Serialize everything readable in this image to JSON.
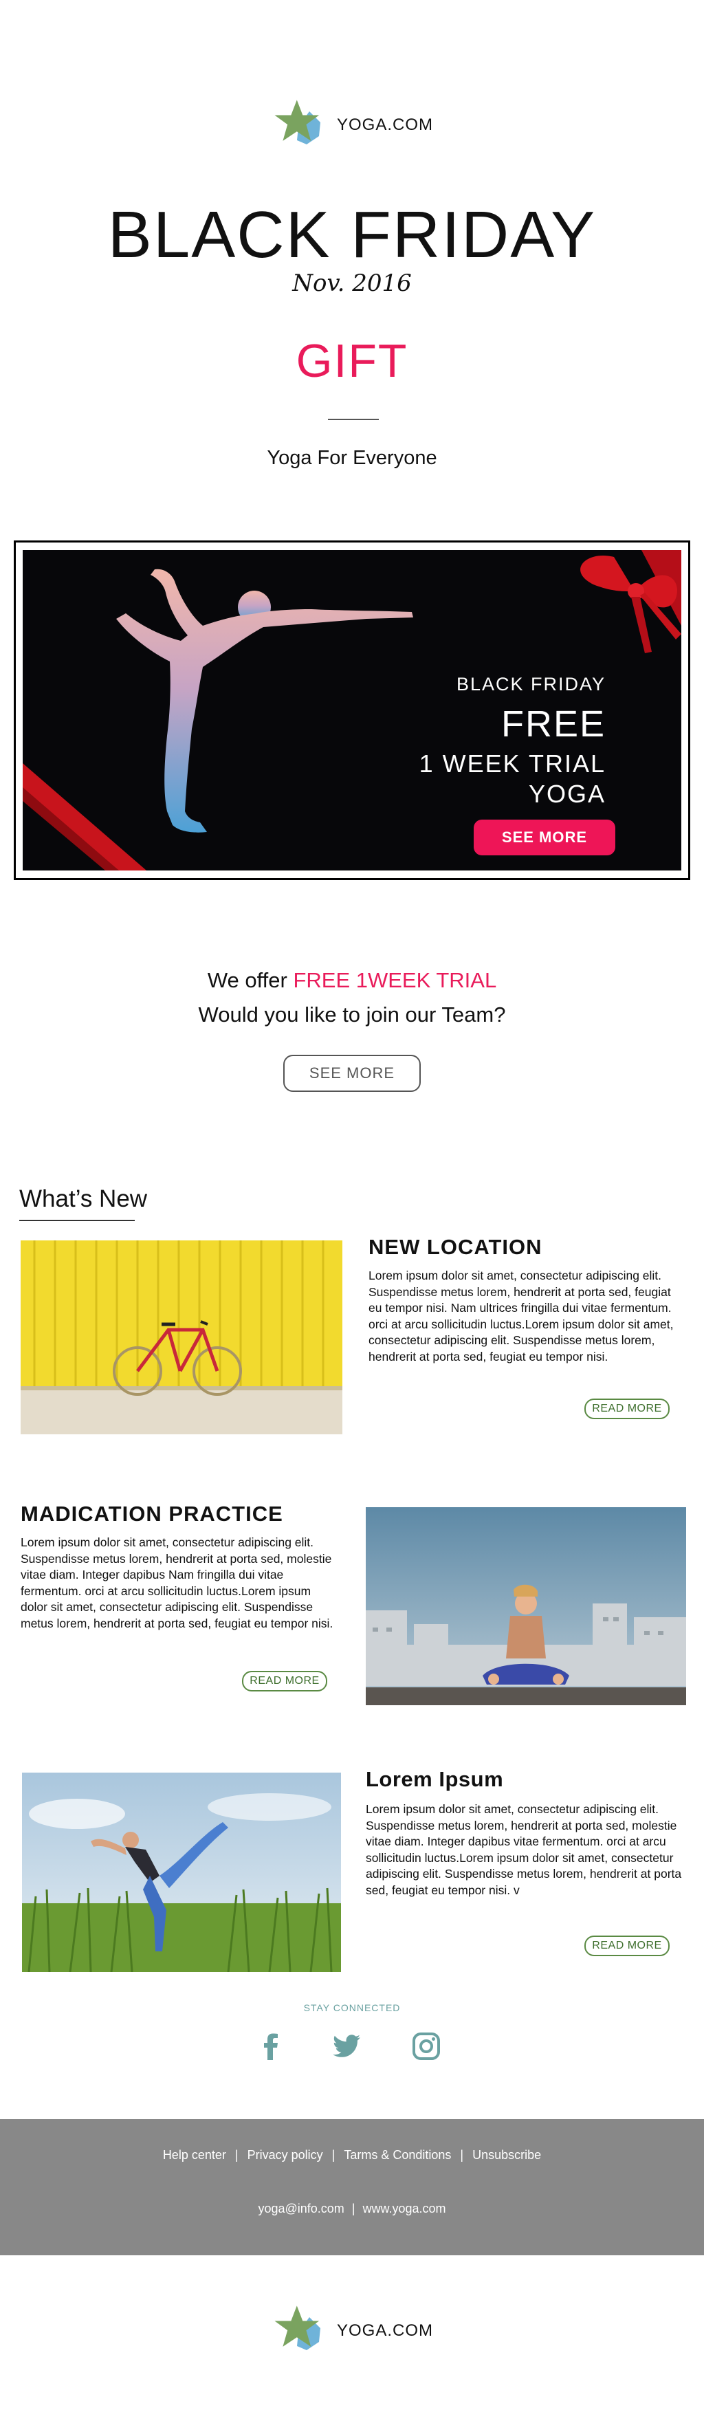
{
  "brand": {
    "name": "YOGA.COM"
  },
  "header": {
    "title": "BLACK FRIDAY",
    "date": "Nov. 2016",
    "gift": "GIFT",
    "tagline": "Yoga For Everyone"
  },
  "banner": {
    "line1": "BLACK FRIDAY",
    "line2": "FREE",
    "line3": "1 WEEK TRIAL",
    "line4": "YOGA",
    "button": "SEE MORE"
  },
  "offer": {
    "prefix": "We offer ",
    "highlight": "FREE 1WEEK TRIAL",
    "question": "Would you like to join our Team?",
    "button": "SEE MORE"
  },
  "whats_new": {
    "title": "What’s New",
    "cards": [
      {
        "heading": "NEW LOCATION",
        "body": "Lorem ipsum dolor sit amet, consectetur adipiscing elit. Suspendisse metus lorem, hendrerit at porta sed, feugiat eu tempor nisi. Nam ultrices fringilla dui vitae fermentum. orci at arcu sollicitudin luctus.Lorem ipsum dolor sit amet, consectetur adipiscing elit. Suspendisse metus lorem, hendrerit at porta sed, feugiat eu tempor nisi.",
        "button": "READ MORE"
      },
      {
        "heading": "MADICATION PRACTICE",
        "body": "Lorem ipsum dolor sit amet, consectetur adipiscing elit. Suspendisse metus lorem, hendrerit at porta sed, molestie vitae diam. Integer dapibus Nam fringilla dui vitae fermentum. orci at arcu sollicitudin luctus.Lorem ipsum dolor sit amet, consectetur adipiscing elit. Suspendisse metus lorem, hendrerit at porta sed, feugiat eu tempor nisi.",
        "button": "READ MORE"
      },
      {
        "heading": "Lorem Ipsum",
        "body": "Lorem ipsum dolor sit amet, consectetur adipiscing elit. Suspendisse metus lorem, hendrerit at porta sed, molestie vitae diam. Integer dapibus vitae fermentum. orci at arcu sollicitudin luctus.Lorem ipsum dolor sit amet, consectetur adipiscing elit. Suspendisse metus lorem, hendrerit at porta sed, feugiat eu tempor nisi. v",
        "button": "READ MORE"
      }
    ]
  },
  "social": {
    "label": "STAY CONNECTED",
    "icons": [
      "facebook-icon",
      "twitter-icon",
      "instagram-icon"
    ]
  },
  "footer": {
    "links": [
      "Help center",
      "Privacy policy",
      "Tarms & Conditions",
      "Unsubscribe"
    ],
    "separator": "|",
    "email": "yoga@info.com",
    "website": "www.yoga.com"
  },
  "colors": {
    "accent_pink": "#e91b5a",
    "button_pink": "#ee1557",
    "read_more_green": "#5a8a43",
    "social_teal": "#6aa1a1",
    "footer_gray": "#888888",
    "logo_green": "#7aa35f",
    "logo_blue": "#6fb3d9"
  }
}
